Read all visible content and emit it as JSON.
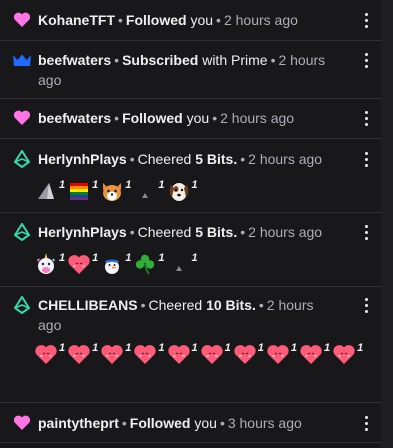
{
  "feed": {
    "items": [
      {
        "user": "KohaneTFT",
        "action": "Followed",
        "rest": "you",
        "time": "2 hours ago",
        "icon": "heart-icon"
      },
      {
        "user": "beefwaters",
        "action": "Subscribed",
        "rest": "with Prime",
        "time": "2 hours",
        "time2": "ago",
        "icon": "crown-icon"
      },
      {
        "user": "beefwaters",
        "action": "Followed",
        "rest": "you",
        "time": "2 hours ago",
        "icon": "heart-icon"
      },
      {
        "user": "HerlynhPlays",
        "pre": "Cheered",
        "bits": "5 Bits.",
        "time": "2 hours ago",
        "icon": "bits-icon",
        "emotes": [
          {
            "name": "cheer-gem-emote",
            "count": "1"
          },
          {
            "name": "pride-flag-emote",
            "count": "1"
          },
          {
            "name": "corgi-emote",
            "count": "1"
          },
          {
            "name": "tiny-triangle-emote",
            "count": "1"
          },
          {
            "name": "dog-emote",
            "count": "1"
          }
        ]
      },
      {
        "user": "HerlynhPlays",
        "pre": "Cheered",
        "bits": "5 Bits.",
        "time": "2 hours ago",
        "icon": "bits-icon",
        "emotes": [
          {
            "name": "unicorn-emote",
            "count": "1"
          },
          {
            "name": "heart-face-emote",
            "count": "1"
          },
          {
            "name": "snowman-emote",
            "count": "1"
          },
          {
            "name": "shamrock-emote",
            "count": "1"
          },
          {
            "name": "tiny-triangle-emote",
            "count": "1"
          }
        ]
      },
      {
        "user": "CHELLIBEANS",
        "pre": "Cheered",
        "bits": "10 Bits.",
        "time": "2 hours",
        "time2": "ago",
        "icon": "bits-icon",
        "emotes": [
          {
            "name": "heart-face-emote",
            "count": "1"
          },
          {
            "name": "heart-face-emote",
            "count": "1"
          },
          {
            "name": "heart-face-emote",
            "count": "1"
          },
          {
            "name": "heart-face-emote",
            "count": "1"
          },
          {
            "name": "heart-face-emote",
            "count": "1"
          },
          {
            "name": "heart-face-emote",
            "count": "1"
          },
          {
            "name": "heart-face-emote",
            "count": "1"
          },
          {
            "name": "heart-face-emote",
            "count": "1"
          },
          {
            "name": "heart-face-emote",
            "count": "1"
          },
          {
            "name": "heart-face-emote",
            "count": "1"
          }
        ]
      },
      {
        "user": "paintytheprt",
        "action": "Followed",
        "rest": "you",
        "time": "3 hours ago",
        "icon": "heart-icon"
      }
    ]
  },
  "colors": {
    "background": "#18181b",
    "heart": "#ff75e6",
    "crown": "#1f69ff",
    "bits": "#34d9a5",
    "separator": "#2f2f35"
  }
}
